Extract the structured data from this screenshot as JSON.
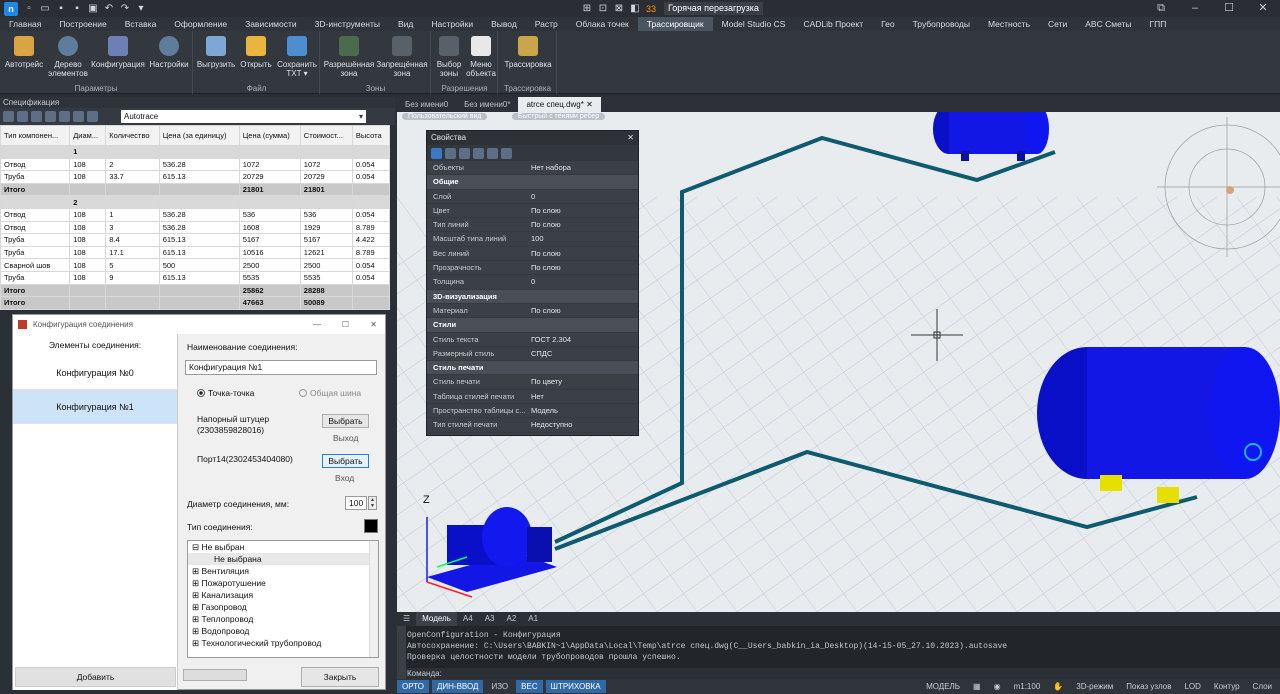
{
  "title": {
    "tag": "Горячая перезагрузка",
    "counter": "33"
  },
  "menu": [
    "Главная",
    "Построение",
    "Вставка",
    "Оформление",
    "Зависимости",
    "3D-инструменты",
    "Вид",
    "Настройки",
    "Вывод",
    "Растр",
    "Облака точек",
    "Трассировщик",
    "Model Studio CS",
    "CADLib Проект",
    "Гео",
    "Трубопроводы",
    "Местность",
    "Сети",
    "ABC Сметы",
    "ГПП"
  ],
  "ribbon": {
    "groups": [
      {
        "title": "Параметры"
      },
      {
        "title": "Файл"
      },
      {
        "title": "Зоны"
      },
      {
        "title": "Разрешения"
      },
      {
        "title": "Трассировка"
      }
    ],
    "buttons": [
      "Автотрейс",
      "Дерево элементов",
      "Конфигурация",
      "Настройки",
      "Выгрузить",
      "Открыть",
      "Сохранить TXT",
      "Разрешённая зона",
      "Запрещённая зона",
      "Выбор зоны",
      "Меню объекта",
      "Трассировка"
    ]
  },
  "spec": {
    "title": "Спецификация",
    "select": "Autotrace",
    "headers": [
      "Тип компонен...",
      "Диам...",
      "Количество",
      "Цена (за единицу)",
      "Цена (сумма)",
      "Стоимост...",
      "Высота"
    ],
    "rows": [
      [
        "",
        "1",
        "",
        "",
        "",
        "",
        ""
      ],
      [
        "Отвод",
        "108",
        "2",
        "536.28",
        "1072",
        "1072",
        "0.054"
      ],
      [
        "Труба",
        "108",
        "33.7",
        "615.13",
        "20729",
        "20729",
        "0.054"
      ],
      [
        "Итого",
        "",
        "",
        "",
        "21801",
        "21801",
        ""
      ],
      [
        "",
        "2",
        "",
        "",
        "",
        "",
        ""
      ],
      [
        "Отвод",
        "108",
        "1",
        "536.28",
        "536",
        "536",
        "0.054"
      ],
      [
        "Отвод",
        "108",
        "3",
        "536.28",
        "1608",
        "1929",
        "8.789"
      ],
      [
        "Труба",
        "108",
        "8.4",
        "615.13",
        "5167",
        "5167",
        "4.422"
      ],
      [
        "Труба",
        "108",
        "17.1",
        "615.13",
        "10516",
        "12621",
        "8.789"
      ],
      [
        "Сварной шов",
        "108",
        "5",
        "500",
        "2500",
        "2500",
        "0.054"
      ],
      [
        "Труба",
        "108",
        "9",
        "615.13",
        "5535",
        "5535",
        "0.054"
      ],
      [
        "Итого",
        "",
        "",
        "",
        "25862",
        "28288",
        ""
      ],
      [
        "Итого",
        "",
        "",
        "",
        "47663",
        "50089",
        ""
      ]
    ]
  },
  "cfg": {
    "title": "Конфигурация соединения",
    "left_header": "Элементы соединения:",
    "items": [
      "Конфигурация №0",
      "Конфигурация №1"
    ],
    "name_label": "Наименование соединения:",
    "name_value": "Конфигурация №1",
    "radio1": "Точка-точка",
    "radio2": "Общая шина",
    "part1": "Напорный штуцер",
    "part1_id": "(2303859828016)",
    "choose": "Выбрать",
    "out": "Выход",
    "part2": "Порт14(2302453404080)",
    "in": "Вход",
    "diam_label": "Диаметр соединения, мм:",
    "diam_value": "100",
    "type_label": "Тип соединения:",
    "tree": [
      "Не выбран",
      "Не выбрана",
      "Вентиляция",
      "Пожаротушение",
      "Канализация",
      "Газопровод",
      "Теплопровод",
      "Водопровод",
      "Технологический трубопровод"
    ],
    "add": "Добавить",
    "close": "Закрыть"
  },
  "doctabs": [
    "Без имени0",
    "Без имени0*",
    "atrce спец.dwg*"
  ],
  "viewlabels": [
    "Пользовательский вид",
    "Быстрый с тенями ребер"
  ],
  "props": {
    "title": "Свойства",
    "rows": [
      {
        "k": "Объекты",
        "v": "Нет набора"
      },
      {
        "sec": "Общие"
      },
      {
        "k": "Слой",
        "v": "0"
      },
      {
        "k": "Цвет",
        "v": "По слою"
      },
      {
        "k": "Тип линий",
        "v": "По слою"
      },
      {
        "k": "Масштаб типа линий",
        "v": "100"
      },
      {
        "k": "Вес линий",
        "v": "По слою"
      },
      {
        "k": "Прозрачность",
        "v": "По слою"
      },
      {
        "k": "Толщина",
        "v": "0"
      },
      {
        "sec": "3D-визуализация"
      },
      {
        "k": "Материал",
        "v": "По слою"
      },
      {
        "sec": "Стили"
      },
      {
        "k": "Стиль текста",
        "v": "ГОСТ 2.304"
      },
      {
        "k": "Размерный стиль",
        "v": "СПДС"
      },
      {
        "sec": "Стиль печати"
      },
      {
        "k": "Стиль печати",
        "v": "По цвету"
      },
      {
        "k": "Таблица стилей печати",
        "v": "Нет"
      },
      {
        "k": "Пространство таблицы с...",
        "v": "Модель"
      },
      {
        "k": "Тип стилей печати",
        "v": "Недоступно"
      }
    ]
  },
  "layouts": [
    "Модель",
    "A4",
    "A3",
    "A2",
    "A1"
  ],
  "cmd": [
    "OpenConfiguration - Конфигурация",
    "Автосохранение: C:\\Users\\BABKIN~1\\AppData\\Local\\Temp\\atrce спец.dwg(C__Users_babkin_ia_Desktop)(14-15-05_27.10.2023).autosave",
    "Проверка целостности модели трубопроводов прошла успешно."
  ],
  "cmd_prompt": "Команда:",
  "status": {
    "left": [
      "ОРТО",
      "ДИН-ВВОД",
      "ИЗО",
      "ВЕС",
      "ШТРИХОВКА"
    ],
    "model": "МОДЕЛЬ",
    "scale": "m1:100",
    "right": [
      "3D-режим",
      "Показ узлов",
      "LOD",
      "Контур",
      "Слои"
    ]
  },
  "axis": "Z"
}
